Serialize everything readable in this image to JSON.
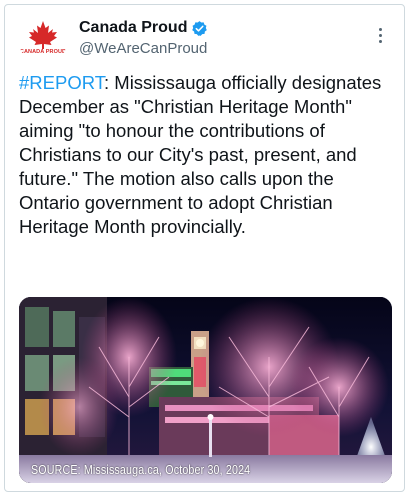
{
  "author": {
    "display_name": "Canada Proud",
    "handle": "@WeAreCanProud",
    "verified": true,
    "avatar_text": "CANADA PROUD"
  },
  "tweet": {
    "hashtag": "#REPORT",
    "body": ": Mississauga officially designates December as \"Christian Heritage Month\" aiming \"to honour the contributions of Christians to our City's past, present, and future.\" The motion also calls upon the Ontario government to adopt Christian Heritage Month provincially."
  },
  "media": {
    "caption": "SOURCE: Mississauga.ca, October 30, 2024"
  },
  "colors": {
    "link": "#1d9bf0",
    "verified_badge": "#1d9bf0",
    "maple_leaf": "#d62828",
    "text": "#0f1419",
    "secondary_text": "#536471"
  },
  "icons": {
    "verified": "verified-badge-icon",
    "more": "more-options-icon",
    "logo": "maple-leaf-icon"
  }
}
